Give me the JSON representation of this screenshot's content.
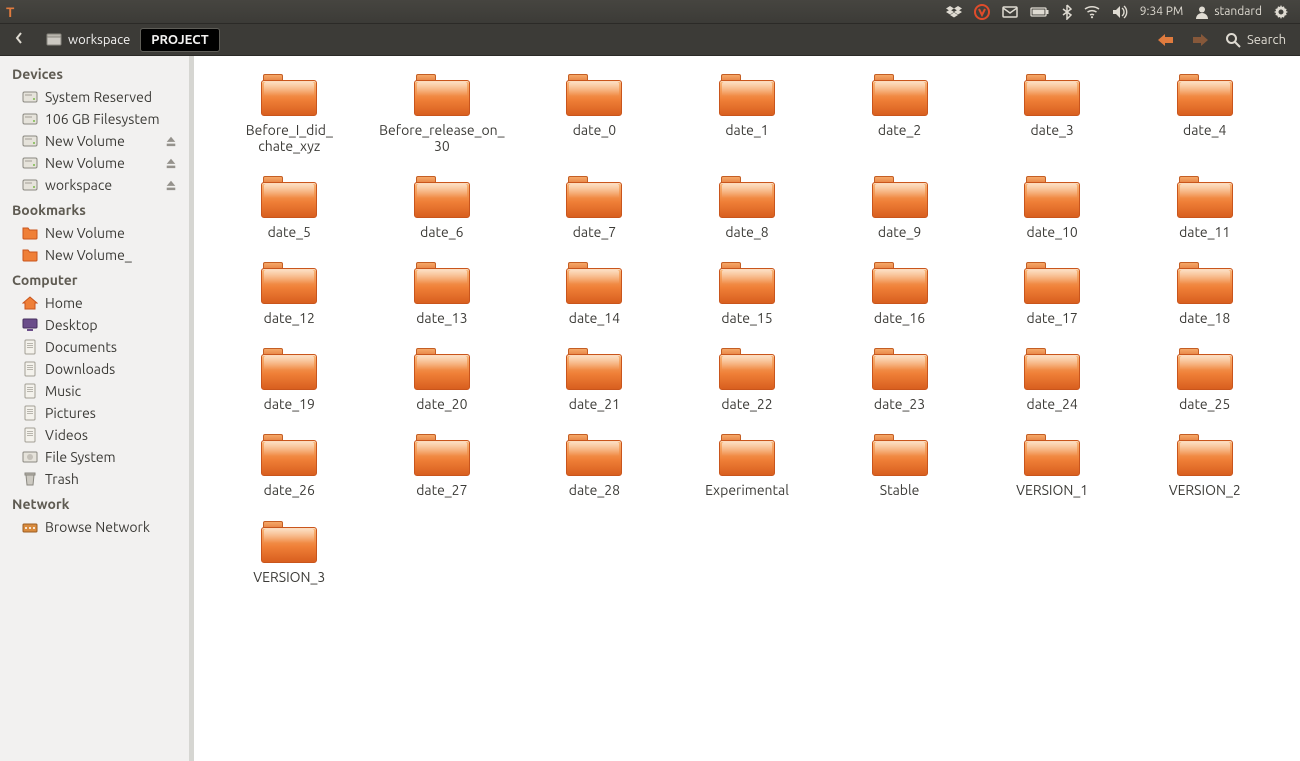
{
  "panel": {
    "time": "9:34 PM",
    "user": "standard"
  },
  "pathbar": {
    "segments": [
      "workspace",
      "PROJECT"
    ],
    "search_label": "Search"
  },
  "sidebar": {
    "groups": [
      {
        "title": "Devices",
        "items": [
          {
            "label": "System Reserved",
            "icon": "hdd",
            "eject": false
          },
          {
            "label": "106 GB Filesystem",
            "icon": "hdd",
            "eject": false
          },
          {
            "label": "New Volume",
            "icon": "hdd",
            "eject": true
          },
          {
            "label": "New Volume",
            "icon": "hdd",
            "eject": true
          },
          {
            "label": "workspace",
            "icon": "hdd",
            "eject": true
          }
        ]
      },
      {
        "title": "Bookmarks",
        "items": [
          {
            "label": "New Volume",
            "icon": "folder",
            "eject": false
          },
          {
            "label": "New Volume_",
            "icon": "folder",
            "eject": false
          }
        ]
      },
      {
        "title": "Computer",
        "items": [
          {
            "label": "Home",
            "icon": "home",
            "eject": false
          },
          {
            "label": "Desktop",
            "icon": "desktop",
            "eject": false
          },
          {
            "label": "Documents",
            "icon": "doc",
            "eject": false
          },
          {
            "label": "Downloads",
            "icon": "doc",
            "eject": false
          },
          {
            "label": "Music",
            "icon": "doc",
            "eject": false
          },
          {
            "label": "Pictures",
            "icon": "doc",
            "eject": false
          },
          {
            "label": "Videos",
            "icon": "doc",
            "eject": false
          },
          {
            "label": "File System",
            "icon": "fs",
            "eject": false
          },
          {
            "label": "Trash",
            "icon": "trash",
            "eject": false
          }
        ]
      },
      {
        "title": "Network",
        "items": [
          {
            "label": "Browse Network",
            "icon": "net",
            "eject": false
          }
        ]
      }
    ]
  },
  "folders": [
    {
      "lines": [
        "Before_I_did_",
        "chate_xyz"
      ]
    },
    {
      "lines": [
        "Before_release_on_",
        "30"
      ]
    },
    {
      "lines": [
        "date_0"
      ]
    },
    {
      "lines": [
        "date_1"
      ]
    },
    {
      "lines": [
        "date_2"
      ]
    },
    {
      "lines": [
        "date_3"
      ]
    },
    {
      "lines": [
        "date_4"
      ]
    },
    {
      "lines": [
        "date_5"
      ]
    },
    {
      "lines": [
        "date_6"
      ]
    },
    {
      "lines": [
        "date_7"
      ]
    },
    {
      "lines": [
        "date_8"
      ]
    },
    {
      "lines": [
        "date_9"
      ]
    },
    {
      "lines": [
        "date_10"
      ]
    },
    {
      "lines": [
        "date_11"
      ]
    },
    {
      "lines": [
        "date_12"
      ]
    },
    {
      "lines": [
        "date_13"
      ]
    },
    {
      "lines": [
        "date_14"
      ]
    },
    {
      "lines": [
        "date_15"
      ]
    },
    {
      "lines": [
        "date_16"
      ]
    },
    {
      "lines": [
        "date_17"
      ]
    },
    {
      "lines": [
        "date_18"
      ]
    },
    {
      "lines": [
        "date_19"
      ]
    },
    {
      "lines": [
        "date_20"
      ]
    },
    {
      "lines": [
        "date_21"
      ]
    },
    {
      "lines": [
        "date_22"
      ]
    },
    {
      "lines": [
        "date_23"
      ]
    },
    {
      "lines": [
        "date_24"
      ]
    },
    {
      "lines": [
        "date_25"
      ]
    },
    {
      "lines": [
        "date_26"
      ]
    },
    {
      "lines": [
        "date_27"
      ]
    },
    {
      "lines": [
        "date_28"
      ]
    },
    {
      "lines": [
        "Experimental"
      ]
    },
    {
      "lines": [
        "Stable"
      ]
    },
    {
      "lines": [
        "VERSION_1"
      ]
    },
    {
      "lines": [
        "VERSION_2"
      ]
    },
    {
      "lines": [
        "VERSION_3"
      ]
    }
  ]
}
